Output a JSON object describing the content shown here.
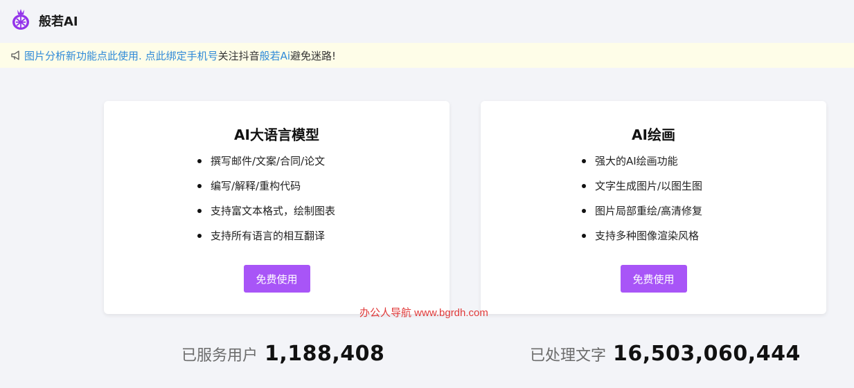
{
  "header": {
    "brand": "般若AI",
    "logo_icon": "pineapple-logo-icon",
    "accent": "#a855f7"
  },
  "notice": {
    "icon": "megaphone-icon",
    "link1": "图片分析新功能点此使用.",
    "link2": "点此绑定手机号",
    "text1": "关注抖音",
    "link3": "般若Ai",
    "text2": "避免迷路!"
  },
  "cards": [
    {
      "title": "AI大语言模型",
      "features": [
        "撰写邮件/文案/合同/论文",
        "编写/解释/重构代码",
        "支持富文本格式，绘制图表",
        "支持所有语言的相互翻译"
      ],
      "button": "免费使用"
    },
    {
      "title": "AI绘画",
      "features": [
        "强大的AI绘画功能",
        "文字生成图片/以图生图",
        "图片局部重绘/高清修复",
        "支持多种图像渲染风格"
      ],
      "button": "免费使用"
    }
  ],
  "watermark": "办公人导航 www.bgrdh.com",
  "stats": [
    {
      "label": "已服务用户",
      "value": "1,188,408"
    },
    {
      "label": "已处理文字",
      "value": "16,503,060,444"
    }
  ]
}
